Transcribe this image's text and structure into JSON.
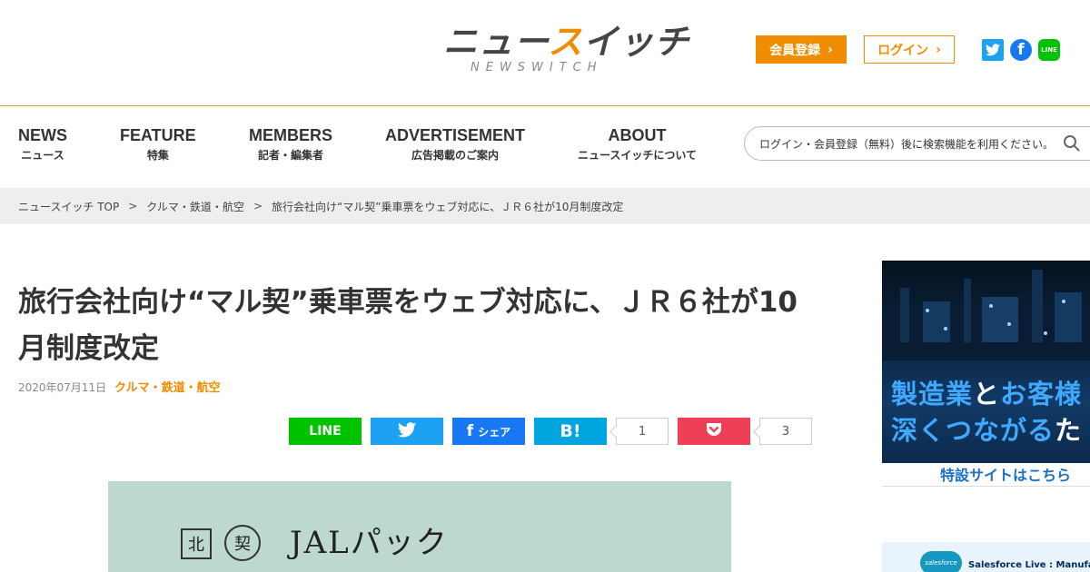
{
  "header": {
    "logo_main_a": "ニュー",
    "logo_main_b": "ス",
    "logo_main_c": "イッチ",
    "logo_sub": "NEWSWITCH",
    "register_label": "会員登録",
    "login_label": "ログイン",
    "brand_accent": "#f08c00"
  },
  "social_icons": [
    "twitter-icon",
    "facebook-icon",
    "line-icon"
  ],
  "nav": {
    "items": [
      {
        "en": "NEWS",
        "ja": "ニュース"
      },
      {
        "en": "FEATURE",
        "ja": "特集"
      },
      {
        "en": "MEMBERS",
        "ja": "記者・編集者"
      },
      {
        "en": "ADVERTISEMENT",
        "ja": "広告掲載のご案内"
      },
      {
        "en": "ABOUT",
        "ja": "ニュースイッチについて"
      }
    ],
    "search_placeholder": "ログイン・会員登録（無料）後に検索機能を利用ください。"
  },
  "breadcrumb": {
    "items": [
      "ニュースイッチ TOP",
      "クルマ・鉄道・航空",
      "旅行会社向け“マル契”乗車票をウェブ対応に、ＪＲ６社が10月制度改定"
    ],
    "separator": ">"
  },
  "article": {
    "title_line1": "旅行会社向け“マル契”乗車票をウェブ対応に、ＪＲ６社が10",
    "title_line2": "月制度改定",
    "date": "2020年07月11日",
    "category": "クルマ・鉄道・航空"
  },
  "share": {
    "line_label": "LINE",
    "facebook_label": "シェア",
    "hatena_label": "B!",
    "hatena_count": "1",
    "pocket_count": "3"
  },
  "photo": {
    "stamp_north": "北",
    "stamp_round": "契",
    "ticket_text": "JALパック"
  },
  "sidebar": {
    "ad1_line1_a": "製造業",
    "ad1_line1_b": "と",
    "ad1_line1_c": "お客様",
    "ad1_line2_a": "深くつながる",
    "ad1_line2_b": "た",
    "ad1_caption": "特設サイトはこちら",
    "ad2_logo": "salesforce",
    "ad2_text": "Salesforce Live : Manufact"
  }
}
